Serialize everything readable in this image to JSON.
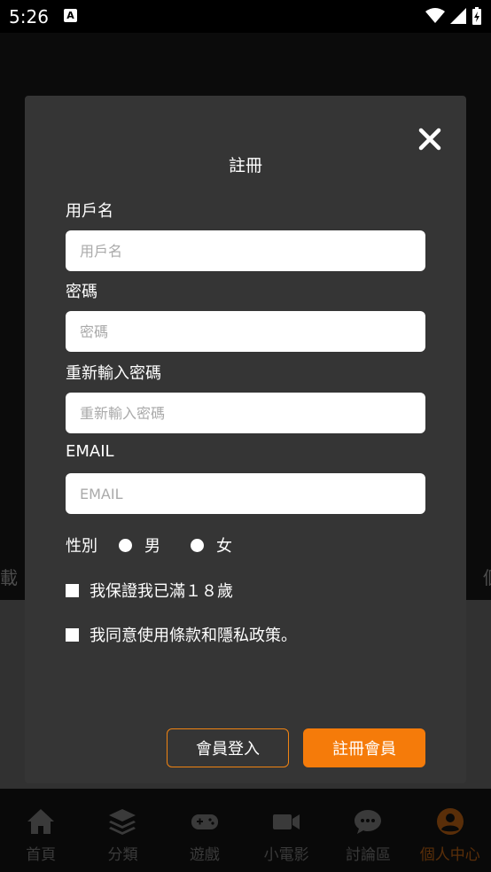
{
  "status": {
    "time": "5:26"
  },
  "background": {
    "left_text": "載",
    "right_text": "個"
  },
  "nav": {
    "items": [
      {
        "label": "首頁"
      },
      {
        "label": "分類"
      },
      {
        "label": "遊戲"
      },
      {
        "label": "小電影"
      },
      {
        "label": "討論區"
      },
      {
        "label": "個人中心"
      }
    ]
  },
  "modal": {
    "title": "註冊",
    "username": {
      "label": "用戶名",
      "placeholder": "用戶名",
      "value": ""
    },
    "password": {
      "label": "密碼",
      "placeholder": "密碼",
      "value": ""
    },
    "confirm_password": {
      "label": "重新輸入密碼",
      "placeholder": "重新輸入密碼",
      "value": ""
    },
    "email": {
      "label": "EMAIL",
      "placeholder": "EMAIL",
      "value": ""
    },
    "gender": {
      "label": "性別",
      "options": [
        "男",
        "女"
      ]
    },
    "age_confirm": "我保證我已滿１８歲",
    "terms_agree": "我同意使用條款和隱私政策。",
    "login_button": "會員登入",
    "register_button": "註冊會員"
  },
  "colors": {
    "accent": "#f57b0a",
    "modal_bg": "#353535",
    "active_nav": "#a35512"
  }
}
